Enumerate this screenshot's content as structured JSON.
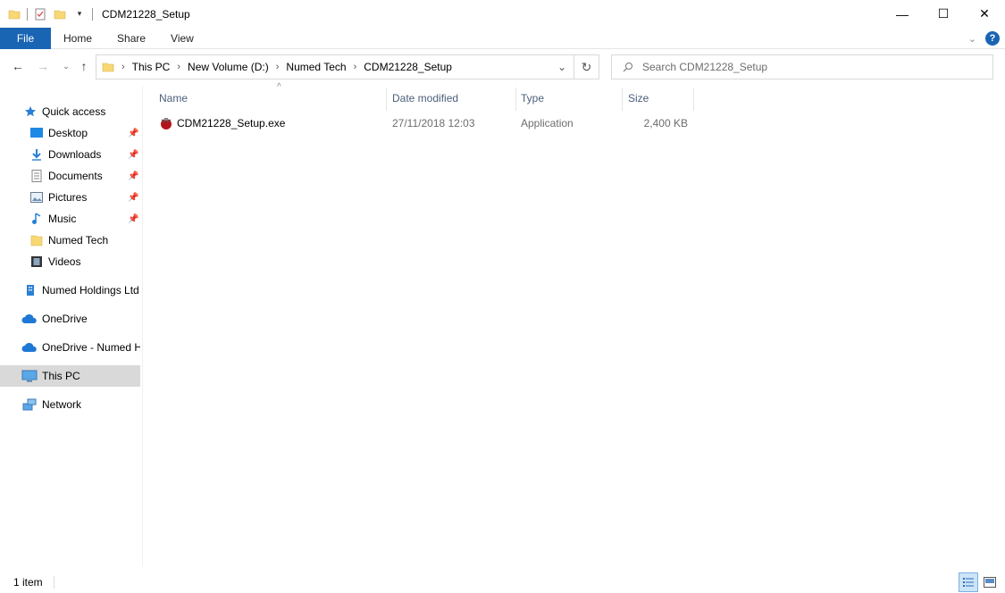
{
  "window": {
    "title": "CDM21228_Setup"
  },
  "window_controls": {
    "minimize": "—",
    "maximize": "☐",
    "close": "✕"
  },
  "ribbon": {
    "tabs": [
      "File",
      "Home",
      "Share",
      "View"
    ]
  },
  "address": {
    "crumbs": [
      "This PC",
      "New Volume (D:)",
      "Numed Tech",
      "CDM21228_Setup"
    ],
    "search_placeholder": "Search CDM21228_Setup"
  },
  "sidebar": {
    "items": [
      {
        "label": "Quick access",
        "icon": "star-icon"
      },
      {
        "label": "Desktop",
        "icon": "desktop-icon",
        "pinned": true
      },
      {
        "label": "Downloads",
        "icon": "download-icon",
        "pinned": true
      },
      {
        "label": "Documents",
        "icon": "documents-icon",
        "pinned": true
      },
      {
        "label": "Pictures",
        "icon": "pictures-icon",
        "pinned": true
      },
      {
        "label": "Music",
        "icon": "music-icon",
        "pinned": true
      },
      {
        "label": "Numed Tech",
        "icon": "folder-icon"
      },
      {
        "label": "Videos",
        "icon": "videos-icon"
      },
      {
        "label": "Numed Holdings Ltd",
        "icon": "building-icon"
      },
      {
        "label": "OneDrive",
        "icon": "cloud-icon"
      },
      {
        "label": "OneDrive - Numed H",
        "icon": "cloud-icon"
      },
      {
        "label": "This PC",
        "icon": "computer-icon",
        "selected": true
      },
      {
        "label": "Network",
        "icon": "network-icon"
      }
    ]
  },
  "columns": {
    "name": "Name",
    "date": "Date modified",
    "type": "Type",
    "size": "Size"
  },
  "files": [
    {
      "name": "CDM21228_Setup.exe",
      "date": "27/11/2018 12:03",
      "type": "Application",
      "size": "2,400 KB",
      "icon": "installer-icon"
    }
  ],
  "status": {
    "count": "1 item"
  },
  "colors": {
    "accent": "#1a64b4",
    "selected": "#d9d9d9",
    "column_header": "#4c607a"
  }
}
